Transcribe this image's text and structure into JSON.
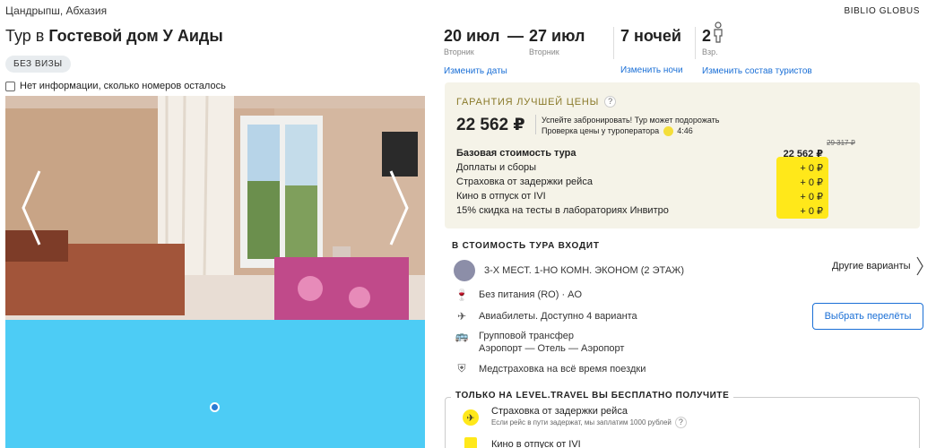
{
  "location": "Цандрыпш, Абхазия",
  "operator": "BIBLIO GLOBUS",
  "title": {
    "prefix": "Тур в",
    "hotel": "Гостевой дом У Аиды"
  },
  "visa_badge": "БЕЗ ВИЗЫ",
  "rooms_info": "Нет информации, сколько номеров осталось",
  "dates": {
    "from": "20 июл",
    "from_day": "Вторник",
    "dash": "—",
    "to": "27 июл",
    "to_day": "Вторник",
    "change_dates": "Изменить даты"
  },
  "nights": {
    "value": "7 ночей",
    "change": "Изменить ночи"
  },
  "tourists": {
    "value": "2",
    "label": "Взр.",
    "change": "Изменить состав туристов"
  },
  "price_box": {
    "guarantee": "ГАРАНТИЯ ЛУЧШЕЙ ЦЕНЫ",
    "question": "?",
    "price": "22 562 ₽",
    "hurry_line1": "Успейте забронировать! Тур может подорожать",
    "hurry_line2": "Проверка цены у туроператора",
    "timer": "4:46",
    "old_price": "29 317 ₽",
    "rows": [
      {
        "label": "Базовая стоимость тура",
        "value": "22 562 ₽"
      },
      {
        "label": "Доплаты и сборы",
        "value": "+ 0 ₽"
      },
      {
        "label": "Страховка от задержки рейса",
        "value": "+ 0 ₽"
      },
      {
        "label": "Кино в отпуск от IVI",
        "value": "+ 0 ₽"
      },
      {
        "label": "15% скидка на тесты в лабораториях Инвитро",
        "value": "+ 0 ₽"
      }
    ]
  },
  "included": {
    "title": "В СТОИМОСТЬ ТУРА ВХОДИТ",
    "room": "3-Х МЕСТ. 1-НО КОМН. ЭКОНОМ (2 ЭТАЖ)",
    "other_variants": "Другие варианты",
    "meal": "Без питания (RO) · AO",
    "flights": "Авиабилеты. Доступно 4 варианта",
    "choose_flights": "Выбрать перелёты",
    "transfer_line1": "Групповой трансфер",
    "transfer_line2": "Аэропорт — Отель — Аэропорт",
    "insurance": "Медстраховка на всё время поездки"
  },
  "bonus": {
    "title": "ТОЛЬКО НА LEVEL.TRAVEL ВЫ БЕСПЛАТНО ПОЛУЧИТЕ",
    "item1_title": "Страховка от задержки рейса",
    "item1_sub": "Если рейс в пути задержат, мы заплатим 1000 рублей",
    "item2_title": "Кино в отпуск от IVI"
  },
  "colors": {
    "accent": "#1a6fd6",
    "highlight": "#ffe81a",
    "price_box_bg": "#f5f3e8",
    "map": "#4dccf5"
  },
  "icons": [
    "nav-left-icon",
    "nav-right-icon",
    "person-icon",
    "timer-icon",
    "meal-icon",
    "plane-icon",
    "bus-icon",
    "shield-icon",
    "chevron-right-icon",
    "bonus-icon"
  ]
}
